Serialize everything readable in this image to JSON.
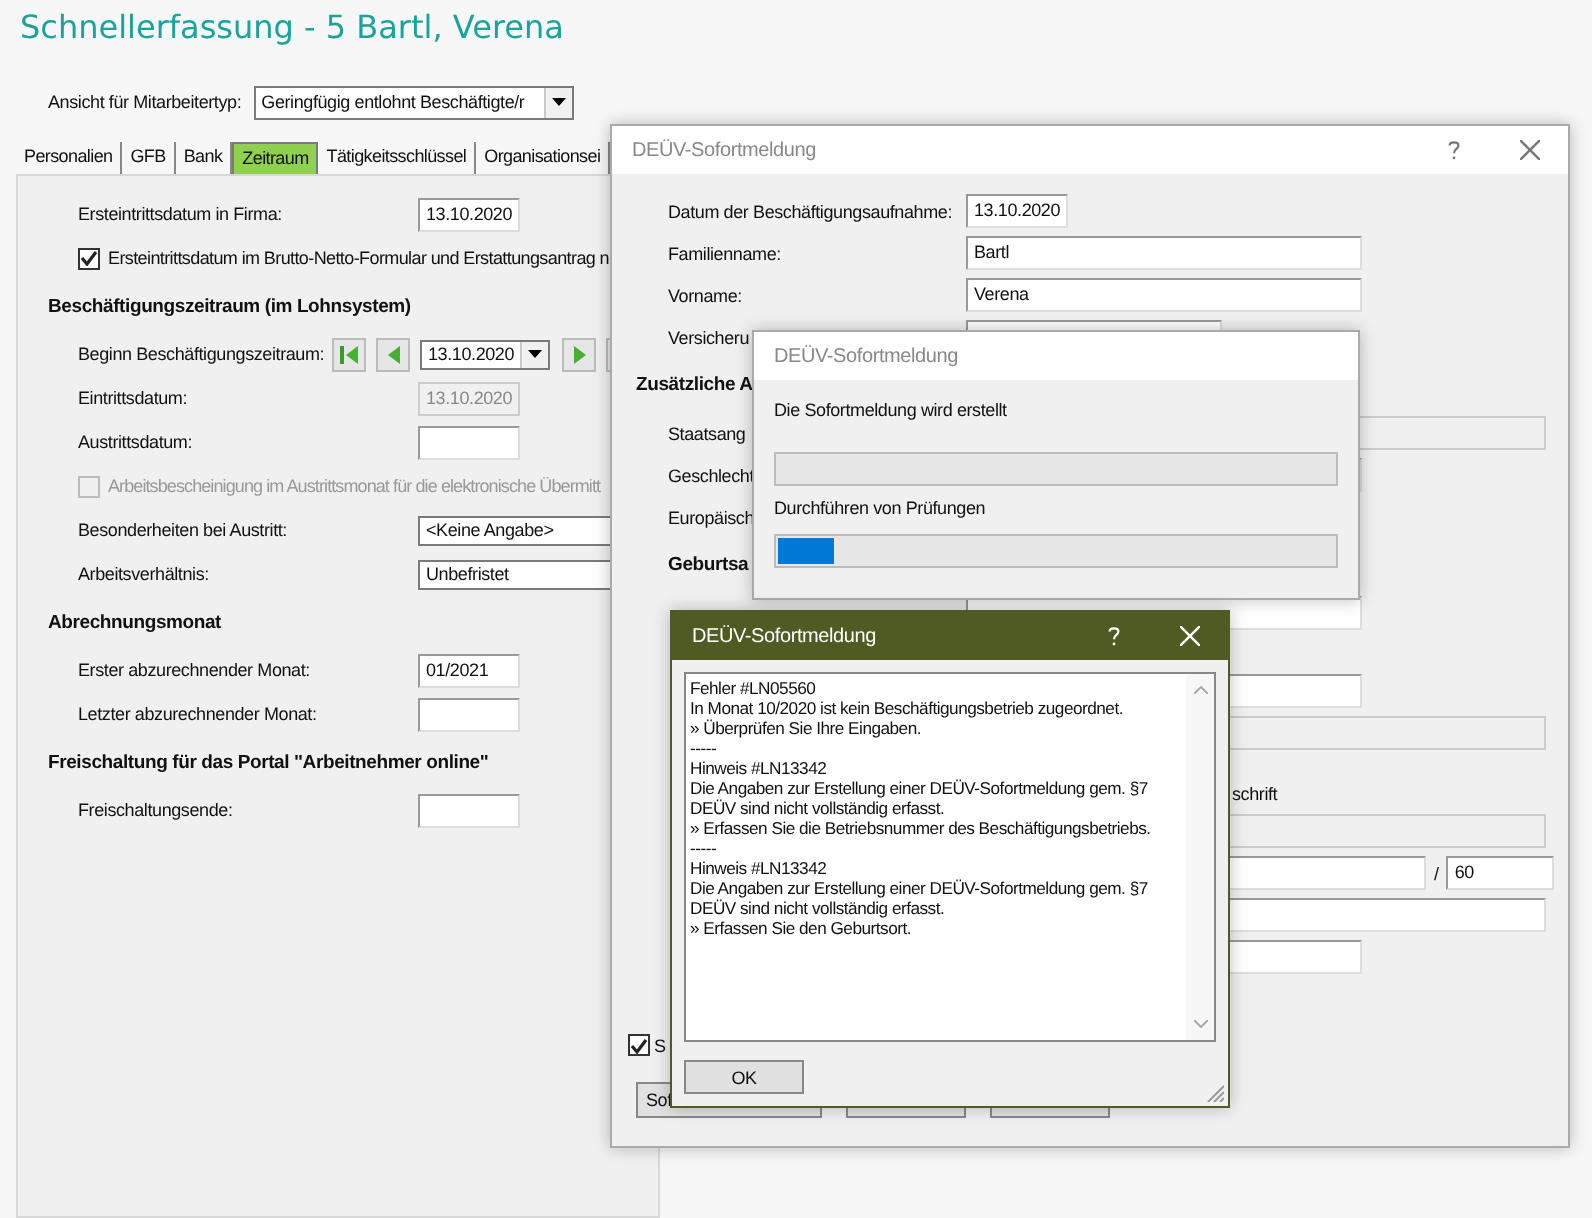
{
  "window": {
    "title": "Schnellerfassung - 5 Bartl, Verena"
  },
  "view_selector": {
    "label": "Ansicht für Mitarbeitertyp:",
    "value": "Geringfügig entlohnt Beschäftigte/r"
  },
  "tabs": [
    {
      "label": "Personalien",
      "selected": false
    },
    {
      "label": "GFB",
      "selected": false
    },
    {
      "label": "Bank",
      "selected": false
    },
    {
      "label": "Zeitraum",
      "selected": true
    },
    {
      "label": "Tätigkeitsschlüssel",
      "selected": false
    },
    {
      "label": "Organisationsei",
      "selected": false
    }
  ],
  "form": [
    {
      "kind": "field",
      "label": "Ersteintrittsdatum in Firma:",
      "value": "13.10.2020",
      "disabled": false
    },
    {
      "kind": "checkbox",
      "label": "Ersteintrittsdatum im Brutto-Netto-Formular und Erstattungsantrag n",
      "checked": true,
      "disabled": false
    },
    {
      "kind": "heading",
      "label": "Beschäftigungszeitraum (im Lohnsystem)"
    },
    {
      "kind": "navigator",
      "label": "Beginn Beschäftigungszeitraum:",
      "value": "13.10.2020"
    },
    {
      "kind": "field",
      "label": "Eintrittsdatum:",
      "value": "13.10.2020",
      "disabled": true
    },
    {
      "kind": "field",
      "label": "Austrittsdatum:",
      "disabled": false
    },
    {
      "kind": "checkbox",
      "label": "Arbeitsbescheinigung im Austrittsmonat für die elektronische Übermitt",
      "checked": false,
      "disabled": true
    },
    {
      "kind": "combo",
      "label": "Besonderheiten bei Austritt:",
      "value": "<Keine Angabe>"
    },
    {
      "kind": "combo",
      "label": "Arbeitsverhältnis:",
      "value": "Unbefristet"
    },
    {
      "kind": "heading",
      "label": "Abrechnungsmonat"
    },
    {
      "kind": "field",
      "label": "Erster abzurechnender Monat:",
      "value": "01/2021",
      "disabled": false
    },
    {
      "kind": "field",
      "label": "Letzter abzurechnender Monat:",
      "disabled": false
    },
    {
      "kind": "heading",
      "label": "Freischaltung für das Portal \"Arbeitnehmer online\""
    },
    {
      "kind": "field",
      "label": "Freischaltungsende:",
      "disabled": false
    }
  ],
  "report_dialog": {
    "title": "DEÜV-Sofortmeldung",
    "rows": [
      {
        "kind": "datefield",
        "label": "Datum der Beschäftigungsaufnahme:",
        "value": "13.10.2020",
        "disabled": false
      },
      {
        "kind": "mediumfield",
        "label": "Familienname:",
        "value": "Bartl",
        "disabled": false
      },
      {
        "kind": "mediumfield",
        "label": "Vorname:",
        "value": "Verena",
        "disabled": false
      },
      {
        "kind": "shortfield",
        "label": "Versicheru",
        "disabled": false
      },
      {
        "kind": "heading",
        "label": "Zusätzliche A"
      },
      {
        "kind": "widefield",
        "label": "Staatsang",
        "disabled": true
      },
      {
        "kind": "mediumfield",
        "label": "Geschlecht",
        "disabled": false
      },
      {
        "kind": "label",
        "label": "Europäisch"
      },
      {
        "kind": "subheading",
        "label": "Geburtsa"
      },
      {
        "kind": "mediumfield",
        "disabled": false
      },
      {
        "kind": "mediumfield",
        "disabled": false
      },
      {
        "kind": "widefield",
        "disabled": true
      },
      {
        "kind": "note",
        "label": "schrift"
      },
      {
        "kind": "widefield",
        "disabled": true
      },
      {
        "kind": "split",
        "separator": "/",
        "value": "60"
      },
      {
        "kind": "widefield",
        "disabled": false
      },
      {
        "kind": "mediumfield",
        "disabled": false
      },
      {
        "kind": "checkbox",
        "label": "S",
        "checked": true
      }
    ],
    "buttons": [
      {
        "label": "Sof"
      }
    ]
  },
  "progress_dialog": {
    "title": "DEÜV-Sofortmeldung",
    "steps": [
      {
        "label": "Die Sofortmeldung wird erstellt",
        "level": 0
      },
      {
        "label": "Durchführen von Prüfungen",
        "level": 0.1
      }
    ]
  },
  "message_dialog": {
    "title": "DEÜV-Sofortmeldung",
    "lines": [
      "Fehler #LN05560",
      "In Monat 10/2020 ist kein Beschäftigungsbetrieb zugeordnet.",
      "» Überprüfen Sie Ihre Eingaben.",
      "-----",
      "Hinweis #LN13342",
      "Die Angaben zur Erstellung einer DEÜV-Sofortmeldung gem. §7",
      "DEÜV sind nicht vollständig erfasst.",
      "» Erfassen Sie die Betriebsnummer des Beschäftigungsbetriebs.",
      "-----",
      "Hinweis #LN13342",
      "Die Angaben zur Erstellung einer DEÜV-Sofortmeldung gem. §7",
      "DEÜV sind nicht vollständig erfasst.",
      "» Erfassen Sie den Geburtsort."
    ],
    "ok_button": "OK"
  }
}
